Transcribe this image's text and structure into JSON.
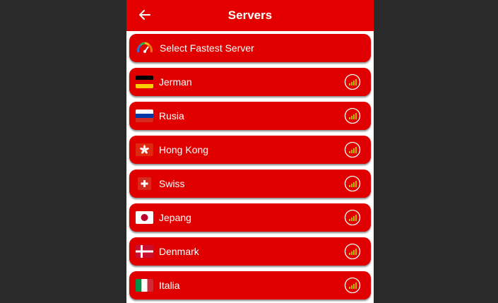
{
  "header": {
    "title": "Servers",
    "back_icon": "arrow-left-icon"
  },
  "fastest": {
    "label": "Select Fastest Server",
    "icon": "speedometer-icon"
  },
  "servers": [
    {
      "label": "Jerman",
      "flag": "germany-flag-icon"
    },
    {
      "label": "Rusia",
      "flag": "russia-flag-icon"
    },
    {
      "label": "Hong Kong",
      "flag": "hong-kong-flag-icon"
    },
    {
      "label": "Swiss",
      "flag": "switzerland-flag-icon"
    },
    {
      "label": "Jepang",
      "flag": "japan-flag-icon"
    },
    {
      "label": "Denmark",
      "flag": "denmark-flag-icon"
    },
    {
      "label": "Italia",
      "flag": "italy-flag-icon"
    }
  ],
  "colors": {
    "accent": "#e40000",
    "item": "#e10000",
    "signal": "#c8b400"
  }
}
